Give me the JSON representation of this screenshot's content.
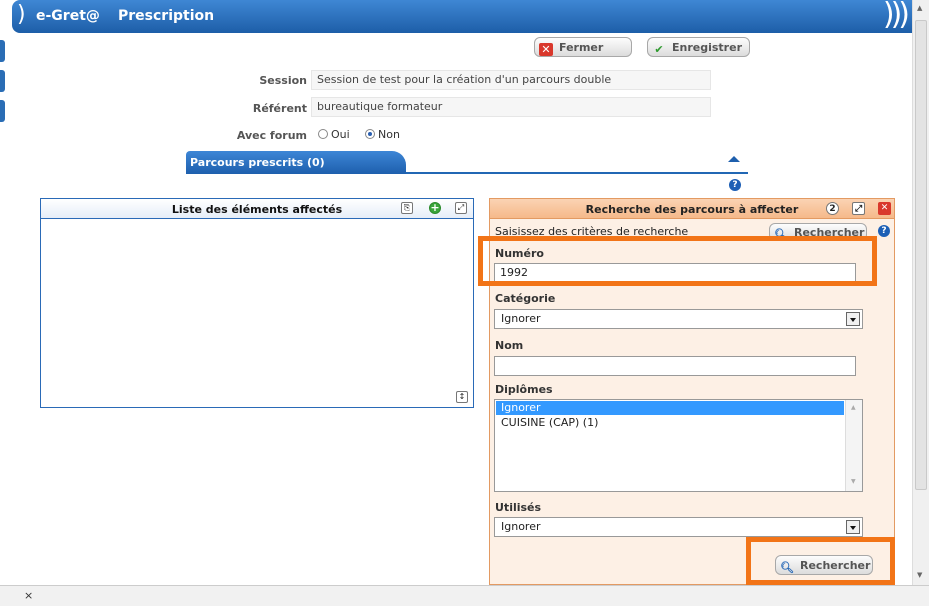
{
  "header": {
    "app_name": "e-Gret@",
    "title": "Prescription"
  },
  "toolbar": {
    "close_label": "Fermer",
    "save_label": "Enregistrer"
  },
  "form": {
    "session_label": "Session",
    "session_value": "Session de test pour la création d'un parcours double",
    "referent_label": "Référent",
    "referent_value": "bureautique formateur",
    "forum_label": "Avec forum",
    "forum_options": [
      "Oui",
      "Non"
    ],
    "forum_selected": "Non"
  },
  "tab": {
    "label": "Parcours prescrits (0)"
  },
  "left_panel": {
    "title": "Liste des éléments affectés"
  },
  "search_panel": {
    "title": "Recherche des parcours à affecter",
    "hint": "Saisissez des critères de recherche",
    "search_button": "Rechercher",
    "numero_label": "Numéro",
    "numero_value": "1992",
    "categorie_label": "Catégorie",
    "categorie_value": "Ignorer",
    "nom_label": "Nom",
    "nom_value": "",
    "diplomes_label": "Diplômes",
    "diplomes_options": [
      "Ignorer",
      "CUISINE (CAP) (1)"
    ],
    "diplomes_selected": "Ignorer",
    "utilises_label": "Utilisés",
    "utilises_value": "Ignorer",
    "bottom_search_button": "Rechercher"
  },
  "statusbar": {
    "close_glyph": "×"
  },
  "colors": {
    "header_blue": "#1d5ea8",
    "highlight_orange": "#f27417",
    "panel_peach": "#fdf0e5"
  }
}
